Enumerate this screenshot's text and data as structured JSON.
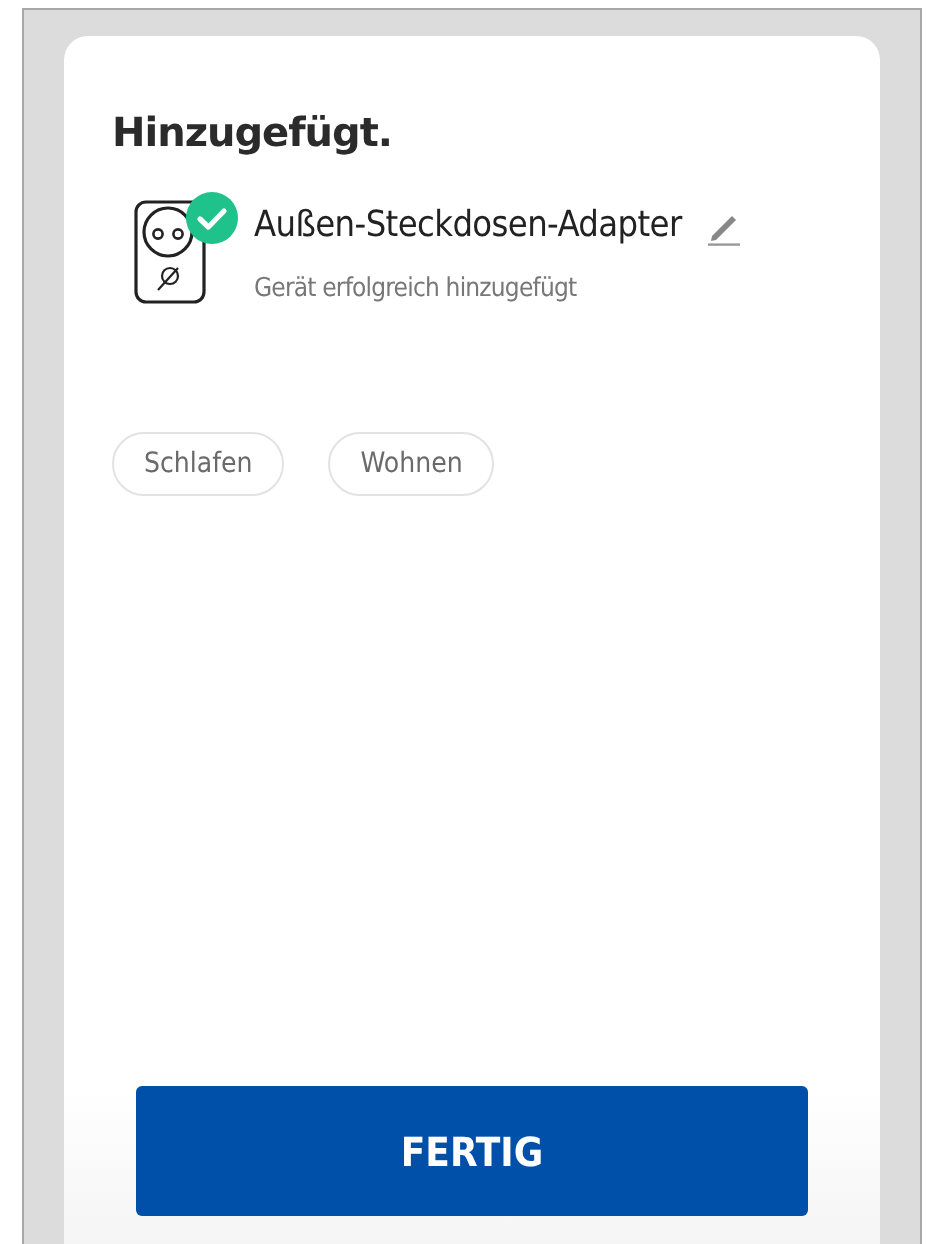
{
  "title": "Hinzugefügt.",
  "device": {
    "name": "Außen-Steckdosen-Adapter",
    "status": "Gerät erfolgreich hinzugefügt"
  },
  "rooms": [
    {
      "label": "Schlafen",
      "selected": false
    },
    {
      "label": "Wohnen",
      "selected": false
    }
  ],
  "button": {
    "label": "FERTIG"
  }
}
